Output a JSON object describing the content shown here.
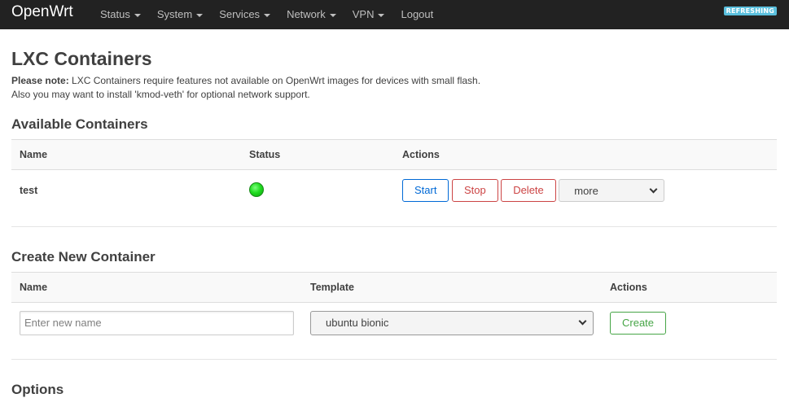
{
  "navbar": {
    "brand": "OpenWrt",
    "menu": [
      {
        "label": "Status",
        "dropdown": true
      },
      {
        "label": "System",
        "dropdown": true
      },
      {
        "label": "Services",
        "dropdown": true
      },
      {
        "label": "Network",
        "dropdown": true
      },
      {
        "label": "VPN",
        "dropdown": true
      },
      {
        "label": "Logout",
        "dropdown": false
      }
    ],
    "badge": "REFRESHING"
  },
  "page": {
    "title": "LXC Containers",
    "note_bold": "Please note:",
    "note_line1": " LXC Containers require features not available on OpenWrt images for devices with small flash.",
    "note_line2": "Also you may want to install 'kmod-veth' for optional network support."
  },
  "available": {
    "heading": "Available Containers",
    "columns": [
      "Name",
      "Status",
      "Actions"
    ],
    "rows": [
      {
        "name": "test",
        "status": "running",
        "status_color": "#22dd22",
        "buttons": {
          "start": "Start",
          "stop": "Stop",
          "delete": "Delete"
        },
        "more_select": "more"
      }
    ]
  },
  "create": {
    "heading": "Create New Container",
    "columns": [
      "Name",
      "Template",
      "Actions"
    ],
    "name_placeholder": "Enter new name",
    "name_value": "",
    "template_selected": "ubuntu bionic",
    "create_label": "Create"
  },
  "options": {
    "heading": "Options"
  },
  "colors": {
    "navbar_bg": "#222222",
    "badge_bg": "#5bc0de",
    "button_blue": "#0069d6",
    "button_red": "#cc4444",
    "button_green": "#46a546"
  }
}
